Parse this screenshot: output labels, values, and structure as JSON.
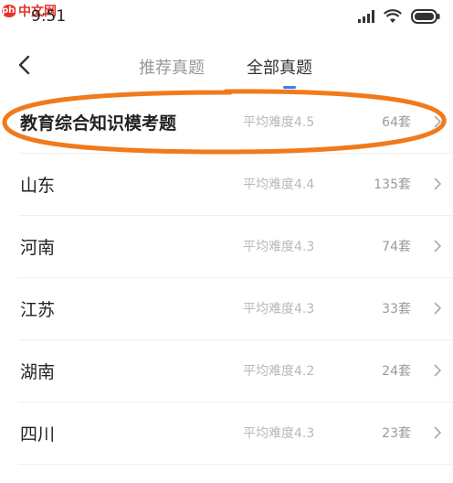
{
  "status_bar": {
    "watermark_logo": "php",
    "watermark_text": "中文网",
    "time": "9:51",
    "icons": [
      "signal-icon",
      "wifi-icon",
      "battery-icon"
    ]
  },
  "nav": {
    "back_icon": "chevron-left-icon",
    "tabs": [
      {
        "label": "推荐真题",
        "active": false
      },
      {
        "label": "全部真题",
        "active": true
      }
    ]
  },
  "list": {
    "rows": [
      {
        "title": "教育综合知识模考题",
        "difficulty": "平均难度4.5",
        "count": "64套",
        "highlighted": true
      },
      {
        "title": "山东",
        "difficulty": "平均难度4.4",
        "count": "135套"
      },
      {
        "title": "河南",
        "difficulty": "平均难度4.3",
        "count": "74套"
      },
      {
        "title": "江苏",
        "difficulty": "平均难度4.3",
        "count": "33套"
      },
      {
        "title": "湖南",
        "difficulty": "平均难度4.2",
        "count": "24套"
      },
      {
        "title": "四川",
        "difficulty": "平均难度4.3",
        "count": "23套"
      }
    ]
  },
  "colors": {
    "accent": "#3f7ef2",
    "annotation": "#f07a1c",
    "watermark": "#e8332a"
  }
}
